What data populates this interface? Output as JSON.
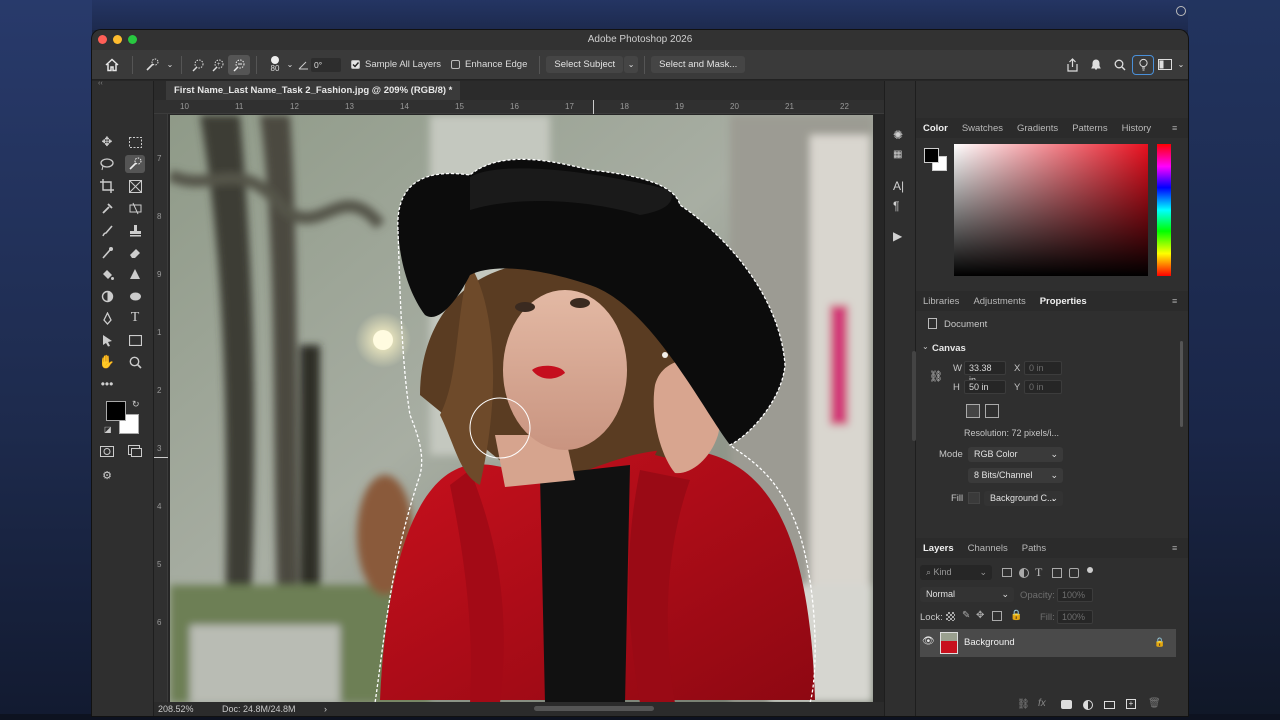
{
  "window": {
    "title": "Adobe Photoshop 2026"
  },
  "options_bar": {
    "brush_size": "80",
    "angle": "0°",
    "sample_all_layers": {
      "label": "Sample All Layers",
      "checked": true
    },
    "enhance_edge": {
      "label": "Enhance Edge",
      "checked": false
    },
    "select_subject_label": "Select Subject",
    "select_and_mask_label": "Select and Mask..."
  },
  "document": {
    "tab_title": "First Name_Last Name_Task 2_Fashion.jpg @ 209% (RGB/8) *",
    "ruler_h": [
      "10",
      "11",
      "12",
      "13",
      "14",
      "15",
      "16",
      "17",
      "18",
      "19",
      "20",
      "21",
      "22"
    ],
    "ruler_v": [
      "7",
      "8",
      "9",
      "1",
      "2",
      "3",
      "4",
      "5",
      "6"
    ]
  },
  "status_bar": {
    "zoom": "208.52%",
    "doc_size": "Doc: 24.8M/24.8M"
  },
  "color_panel": {
    "tabs": [
      "Color",
      "Swatches",
      "Gradients",
      "Patterns",
      "History"
    ],
    "active_tab": "Color",
    "hue_color": "#e8101f"
  },
  "properties_panel": {
    "tabs": [
      "Libraries",
      "Adjustments",
      "Properties"
    ],
    "active_tab": "Properties",
    "doc_label": "Document",
    "canvas_section": "Canvas",
    "width_label": "W",
    "width_value": "33.38 in",
    "height_label": "H",
    "height_value": "50 in",
    "x_label": "X",
    "x_value": "0 in",
    "y_label": "Y",
    "y_value": "0 in",
    "resolution": "Resolution: 72 pixels/i...",
    "mode_label": "Mode",
    "mode_value": "RGB Color",
    "bits_value": "8 Bits/Channel",
    "fill_label": "Fill",
    "fill_value": "Background C..."
  },
  "layers_panel": {
    "tabs": [
      "Layers",
      "Channels",
      "Paths"
    ],
    "active_tab": "Layers",
    "kind_placeholder": "Kind",
    "blend_mode": "Normal",
    "opacity_label": "Opacity:",
    "opacity_value": "100%",
    "lock_label": "Lock:",
    "fill_label": "Fill:",
    "fill_value": "100%",
    "layers": [
      {
        "name": "Background",
        "visible": true,
        "locked": true
      }
    ]
  },
  "colors": {
    "accent": "#c7101c",
    "panel_bg": "#2f2f2f"
  }
}
